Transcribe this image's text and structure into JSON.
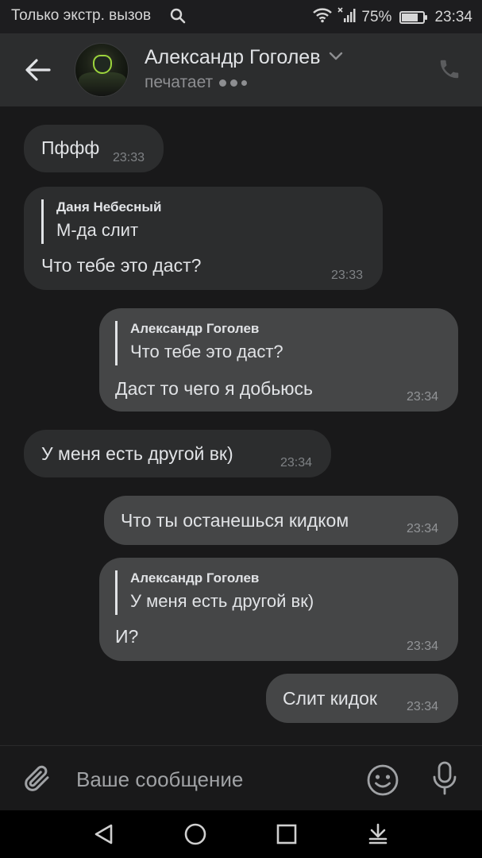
{
  "status_bar": {
    "carrier": "Только экстр. вызов",
    "battery_percent": "75%",
    "battery_level": 0.75,
    "time": "23:34",
    "icons": [
      "search-icon",
      "wifi-icon",
      "signal-icon",
      "battery-icon"
    ]
  },
  "header": {
    "contact_name": "Александр Гоголев",
    "status": "печатает",
    "icons": [
      "back-arrow-icon",
      "chevron-down-icon",
      "phone-icon"
    ]
  },
  "messages": [
    {
      "direction": "incoming",
      "text": "Пффф",
      "time": "23:33"
    },
    {
      "direction": "incoming",
      "reply_author": "Даня Небесный",
      "reply_text": "М-да слит",
      "text": "Что тебе это даст?",
      "time": "23:33"
    },
    {
      "direction": "outgoing",
      "reply_author": "Александр Гоголев",
      "reply_text": "Что тебе это даст?",
      "text": "Даст то чего я добьюсь",
      "time": "23:34"
    },
    {
      "direction": "incoming",
      "text": "У меня есть другой вк)",
      "time": "23:34"
    },
    {
      "direction": "outgoing",
      "text": "Что ты останешься кидком",
      "time": "23:34"
    },
    {
      "direction": "outgoing",
      "reply_author": "Александр Гоголев",
      "reply_text": "У меня есть другой вк)",
      "text": "И?",
      "time": "23:34"
    },
    {
      "direction": "outgoing",
      "text": "Слит кидок",
      "time": "23:34"
    }
  ],
  "composer": {
    "placeholder": "Ваше сообщение",
    "icons": [
      "paperclip-icon",
      "smile-icon",
      "microphone-icon"
    ]
  },
  "navbar": {
    "icons": [
      "nav-back-icon",
      "nav-home-icon",
      "nav-recents-icon",
      "nav-notifications-icon"
    ]
  },
  "colors": {
    "background": "#19191a",
    "header": "#2c2d2e",
    "incoming_bubble": "#2c2d2e",
    "outgoing_bubble": "#454647",
    "text": "#e1e3e6",
    "secondary_text": "#8d8e91"
  }
}
